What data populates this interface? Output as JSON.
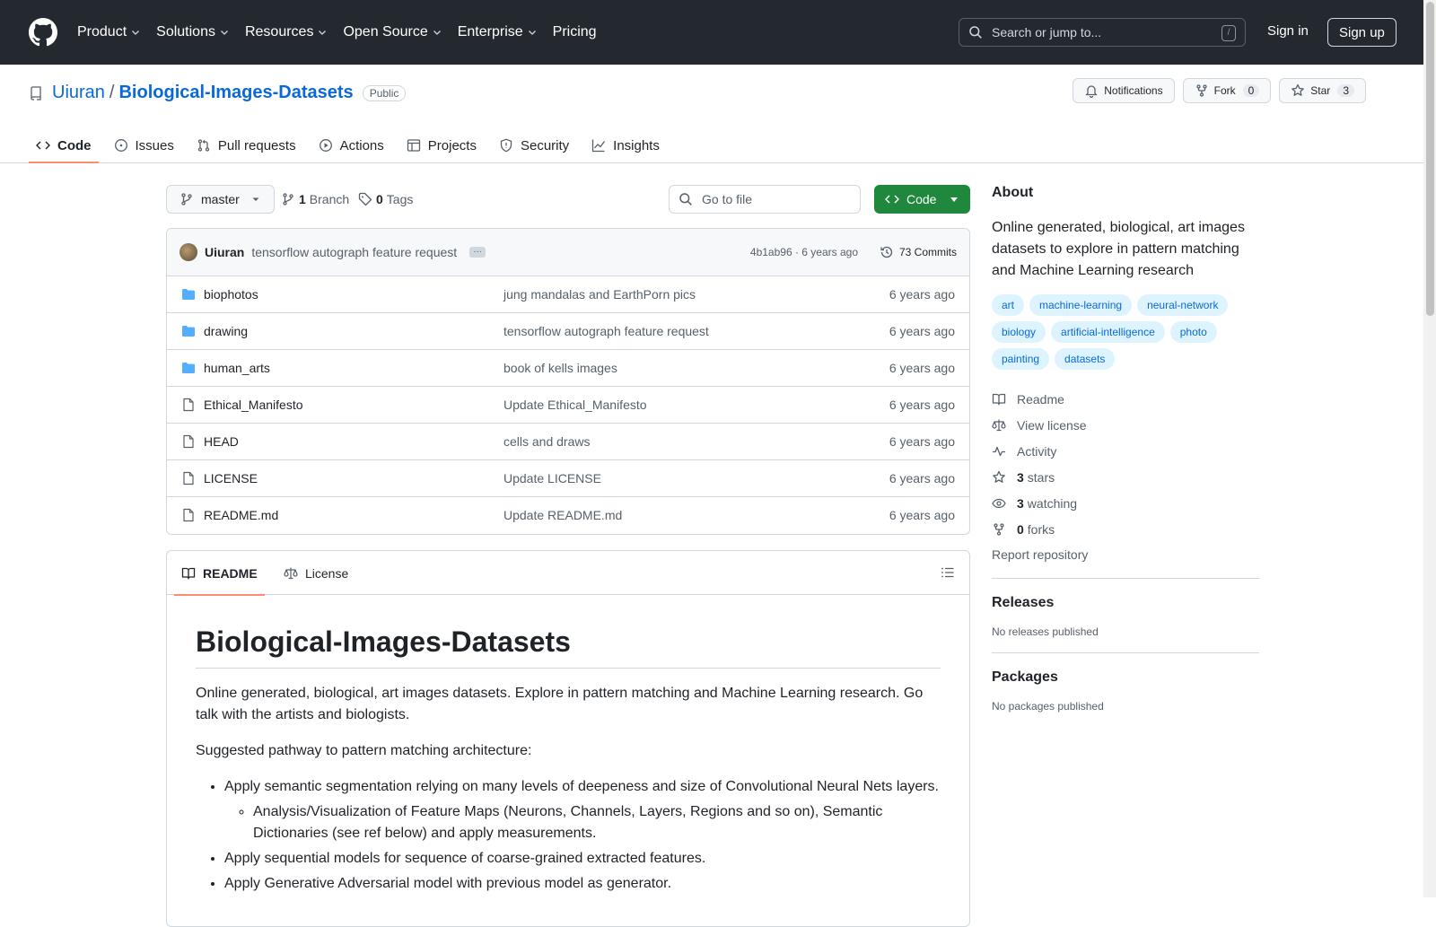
{
  "header": {
    "nav": [
      "Product",
      "Solutions",
      "Resources",
      "Open Source",
      "Enterprise",
      "Pricing"
    ],
    "search_placeholder": "Search or jump to...",
    "search_shortcut": "/",
    "signin": "Sign in",
    "signup": "Sign up"
  },
  "repo": {
    "owner": "Uiuran",
    "separator": "/",
    "name": "Biological-Images-Datasets",
    "visibility": "Public",
    "notifications_label": "Notifications",
    "fork_label": "Fork",
    "fork_count": "0",
    "star_label": "Star",
    "star_count": "3"
  },
  "tabs": [
    "Code",
    "Issues",
    "Pull requests",
    "Actions",
    "Projects",
    "Security",
    "Insights"
  ],
  "toolbar": {
    "branch": "master",
    "branch_count": "1",
    "branch_label": "Branch",
    "tag_count": "0",
    "tag_label": "Tags",
    "goto_placeholder": "Go to file",
    "code_button": "Code"
  },
  "commit": {
    "author": "Uiuran",
    "message": "tensorflow autograph feature request",
    "sha_time": "4b1ab96 · 6 years ago",
    "commits": "73 Commits"
  },
  "files": [
    {
      "type": "folder",
      "name": "biophotos",
      "message": "jung mandalas and EarthPorn pics",
      "date": "6 years ago"
    },
    {
      "type": "folder",
      "name": "drawing",
      "message": "tensorflow autograph feature request",
      "date": "6 years ago"
    },
    {
      "type": "folder",
      "name": "human_arts",
      "message": "book of kells images",
      "date": "6 years ago"
    },
    {
      "type": "file",
      "name": "Ethical_Manifesto",
      "message": "Update Ethical_Manifesto",
      "date": "6 years ago"
    },
    {
      "type": "file",
      "name": "HEAD",
      "message": "cells and draws",
      "date": "6 years ago"
    },
    {
      "type": "file",
      "name": "LICENSE",
      "message": "Update LICENSE",
      "date": "6 years ago"
    },
    {
      "type": "file",
      "name": "README.md",
      "message": "Update README.md",
      "date": "6 years ago"
    }
  ],
  "readme": {
    "tab_readme": "README",
    "tab_license": "License",
    "title": "Biological-Images-Datasets",
    "para1": "Online generated, biological, art images datasets. Explore in pattern matching and Machine Learning research. Go talk with the artists and biologists.",
    "para2": "Suggested pathway to pattern matching architecture:",
    "bullet1": "Apply semantic segmentation relying on many levels of deepeness and size of Convolutional Neural Nets layers.",
    "sub_bullet1": "Analysis/Visualization of Feature Maps (Neurons, Channels, Layers, Regions and so on), Semantic Dictionaries (see ref below) and apply measurements.",
    "bullet2": "Apply sequential models for sequence of coarse-grained extracted features.",
    "bullet3": "Apply Generative Adversarial model with previous model as generator."
  },
  "about": {
    "heading": "About",
    "description": "Online generated, biological, art images datasets to explore in pattern matching and Machine Learning research",
    "topics": [
      "art",
      "machine-learning",
      "neural-network",
      "biology",
      "artificial-intelligence",
      "photo",
      "painting",
      "datasets"
    ],
    "readme": "Readme",
    "license": "View license",
    "activity": "Activity",
    "stars_count": "3",
    "stars_label": "stars",
    "watching_count": "3",
    "watching_label": "watching",
    "forks_count": "0",
    "forks_label": "forks",
    "report": "Report repository"
  },
  "releases": {
    "heading": "Releases",
    "text": "No releases published"
  },
  "packages": {
    "heading": "Packages",
    "text": "No packages published"
  },
  "colors": {
    "link": "#0969da",
    "header_bg": "#24292f",
    "code_button": "#1f883d",
    "tab_underline": "#fd8c73"
  }
}
